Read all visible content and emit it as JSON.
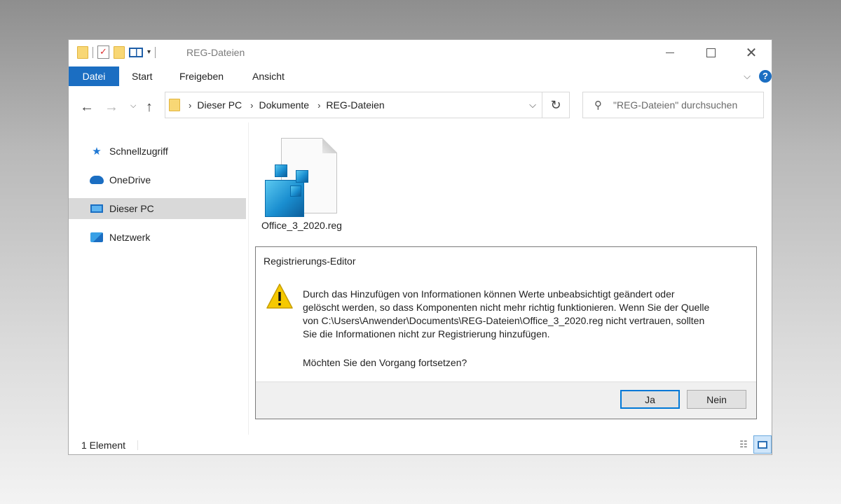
{
  "window": {
    "title": "REG-Dateien",
    "controls": {
      "minimize_icon": "minimize-icon",
      "maximize_icon": "maximize-icon",
      "close_icon": "close-icon"
    }
  },
  "ribbon": {
    "tabs": [
      {
        "label": "Datei",
        "active": true
      },
      {
        "label": "Start"
      },
      {
        "label": "Freigeben"
      },
      {
        "label": "Ansicht"
      }
    ],
    "help_icon": "?"
  },
  "address_bar": {
    "breadcrumb": [
      "Dieser PC",
      "Dokumente",
      "REG-Dateien"
    ],
    "separator": "›"
  },
  "search": {
    "placeholder": "\"REG-Dateien\" durchsuchen"
  },
  "sidebar": {
    "items": [
      {
        "label": "Schnellzugriff",
        "icon": "star-icon"
      },
      {
        "label": "OneDrive",
        "icon": "cloud-icon"
      },
      {
        "label": "Dieser PC",
        "icon": "computer-icon",
        "selected": true
      },
      {
        "label": "Netzwerk",
        "icon": "network-icon"
      }
    ]
  },
  "files": [
    {
      "name": "Office_3_2020.reg",
      "icon": "registry-file-icon"
    }
  ],
  "status_bar": {
    "item_count": "1 Element"
  },
  "dialog": {
    "title": "Registrierungs-Editor",
    "message_lines": [
      "Durch das Hinzufügen von Informationen können Werte unbeabsichtigt geändert oder",
      "gelöscht werden, so dass Komponenten nicht mehr richtig funktionieren. Wenn Sie der Quelle",
      "von C:\\Users\\Anwender\\Documents\\REG-Dateien\\Office_3_2020.reg nicht vertrauen, sollten",
      "Sie die Informationen nicht zur Registrierung hinzufügen."
    ],
    "question": "Möchten Sie den Vorgang fortsetzen?",
    "buttons": {
      "yes": "Ja",
      "no": "Nein"
    }
  },
  "colors": {
    "accent": "#1b6ec2",
    "selection": "#d9d9d9",
    "warning": "#f6c900"
  }
}
